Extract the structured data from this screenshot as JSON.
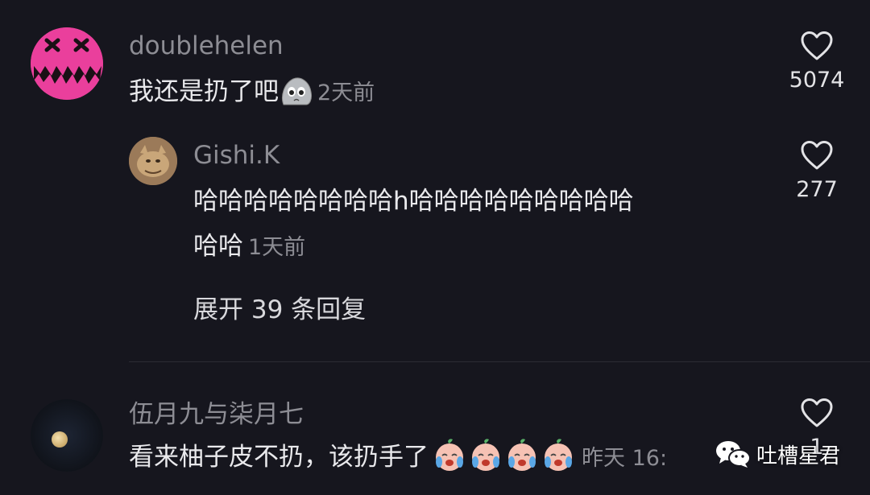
{
  "comments": [
    {
      "username": "doublehelen",
      "text": "我还是扔了吧",
      "emoji": "pleading-stone-face-emoji",
      "time": "2天前",
      "likes": "5074",
      "avatar": "pink-x-eyes-face-avatar",
      "replies": [
        {
          "username": "Gishi.K",
          "text_line1": "哈哈哈哈哈哈哈哈h哈哈哈哈哈哈哈哈哈",
          "text_line2": "哈哈",
          "time": "1天前",
          "likes": "277",
          "avatar": "cat-photo-avatar"
        }
      ],
      "expand_label": "展开 39 条回复"
    },
    {
      "username": "伍月九与柒月七",
      "text": "看来柚子皮不扔，该扔手了",
      "emoji": "crying-peach-emoji",
      "time": "昨天 16:",
      "likes": "1",
      "avatar": "moon-avatar"
    }
  ],
  "icons": {
    "like": "heart-outline-icon"
  },
  "watermark": {
    "label": "吐槽星君",
    "icon": "wechat-icon"
  },
  "colors": {
    "background": "#16161e",
    "username": "#8d8d94",
    "text": "#e9e9ec",
    "avatar_pink": "#ea3f9c"
  }
}
